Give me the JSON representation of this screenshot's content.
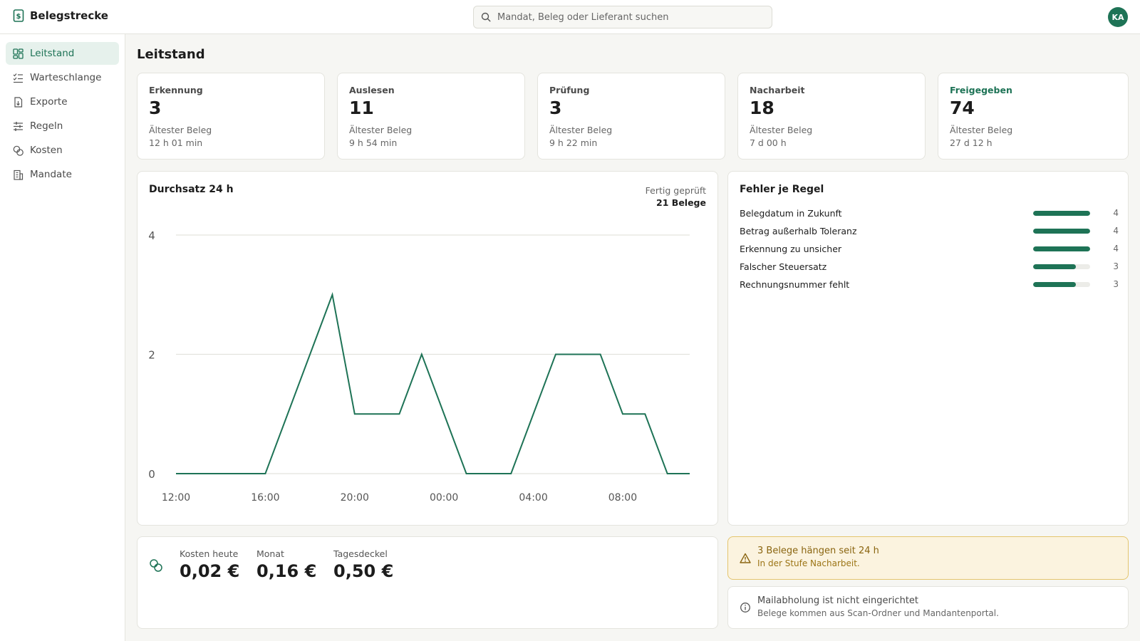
{
  "app": {
    "name": "Belegstrecke"
  },
  "search": {
    "placeholder": "Mandat, Beleg oder Lieferant suchen"
  },
  "user": {
    "initials": "KA"
  },
  "sidebar": {
    "items": [
      {
        "label": "Leitstand",
        "icon": "dashboard-icon",
        "active": true
      },
      {
        "label": "Warteschlange",
        "icon": "checklist-icon"
      },
      {
        "label": "Exporte",
        "icon": "file-export-icon"
      },
      {
        "label": "Regeln",
        "icon": "sliders-icon"
      },
      {
        "label": "Kosten",
        "icon": "coins-icon"
      },
      {
        "label": "Mandate",
        "icon": "building-icon"
      }
    ]
  },
  "page": {
    "title": "Leitstand"
  },
  "stages": [
    {
      "label": "Erkennung",
      "count": "3",
      "sub": "Ältester Beleg",
      "age": "12 h 01 min"
    },
    {
      "label": "Auslesen",
      "count": "11",
      "sub": "Ältester Beleg",
      "age": "9 h 54 min"
    },
    {
      "label": "Prüfung",
      "count": "3",
      "sub": "Ältester Beleg",
      "age": "9 h 22 min"
    },
    {
      "label": "Nacharbeit",
      "count": "18",
      "sub": "Ältester Beleg",
      "age": "7 d 00 h"
    },
    {
      "label": "Freigegeben",
      "count": "74",
      "sub": "Ältester Beleg",
      "age": "27 d 12 h",
      "accent": "#1e7356"
    }
  ],
  "throughput": {
    "title": "Durchsatz 24 h",
    "meta_label": "Fertig geprüft",
    "meta_value": "21 Belege"
  },
  "chart_data": {
    "type": "line",
    "x": [
      "12:00",
      "13:00",
      "14:00",
      "15:00",
      "16:00",
      "17:00",
      "18:00",
      "19:00",
      "20:00",
      "21:00",
      "22:00",
      "23:00",
      "00:00",
      "01:00",
      "02:00",
      "03:00",
      "04:00",
      "05:00",
      "06:00",
      "07:00",
      "08:00",
      "09:00",
      "10:00",
      "11:00"
    ],
    "series": [
      {
        "values": [
          0,
          0,
          0,
          0,
          0,
          1,
          2,
          3,
          1,
          1,
          1,
          2,
          1,
          0,
          0,
          0,
          1,
          2,
          2,
          2,
          1,
          1,
          0,
          0
        ]
      }
    ],
    "xticks": [
      "12:00",
      "16:00",
      "20:00",
      "00:00",
      "04:00",
      "08:00"
    ],
    "yticks": [
      0,
      2,
      4
    ],
    "ylim": [
      0,
      4
    ],
    "grid": true,
    "color": "#1e7356"
  },
  "errors": {
    "title": "Fehler je Regel",
    "max": 4,
    "rules": [
      {
        "name": "Belegdatum in Zukunft",
        "count": 4
      },
      {
        "name": "Betrag außerhalb Toleranz",
        "count": 4
      },
      {
        "name": "Erkennung zu unsicher",
        "count": 4
      },
      {
        "name": "Falscher Steuersatz",
        "count": 3
      },
      {
        "name": "Rechnungsnummer fehlt",
        "count": 3
      }
    ]
  },
  "costs": {
    "today_label": "Kosten heute",
    "today": "0,02 €",
    "month_label": "Monat",
    "month": "0,16 €",
    "cap_label": "Tagesdeckel",
    "cap": "0,50 €"
  },
  "alerts": {
    "warning": {
      "title": "3 Belege hängen seit 24 h",
      "text": "In der Stufe Nacharbeit."
    },
    "info": {
      "title": "Mailabholung ist nicht eingerichtet",
      "text": "Belege kommen aus Scan-Ordner und Mandantenportal."
    }
  }
}
